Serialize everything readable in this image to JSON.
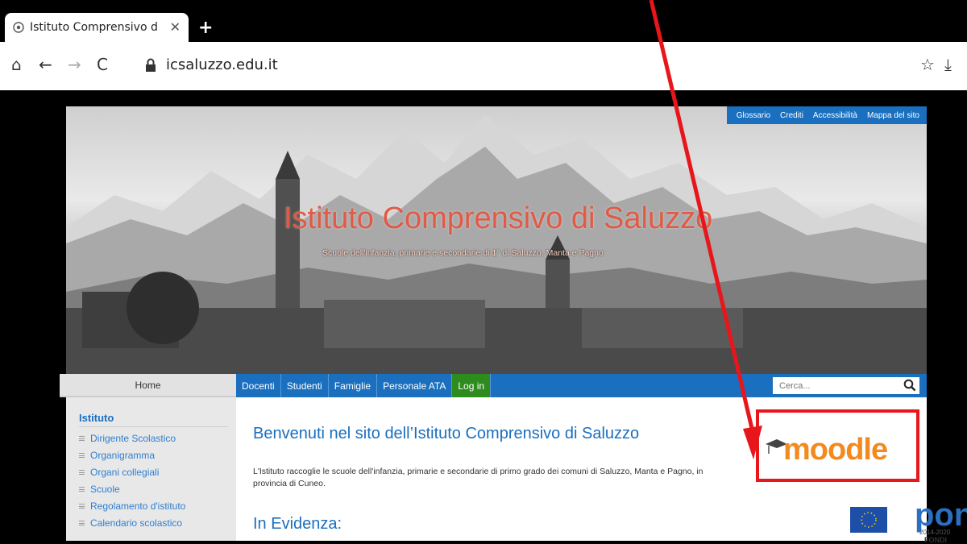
{
  "browser": {
    "tab_title": "Istituto Comprensivo di S",
    "url": "icsaluzzo.edu.it"
  },
  "site": {
    "toplinks": [
      "Glossario",
      "Crediti",
      "Accessibilità",
      "Mappa del sito"
    ],
    "title": "Istituto Comprensivo di Saluzzo",
    "subtitle": "Scuole dell'infanzia, primarie e secondarie di 1° di Saluzzo, Manta e Pagno",
    "nav": {
      "home": "Home",
      "items": [
        "Docenti",
        "Studenti",
        "Famiglie",
        "Personale ATA",
        "Log in"
      ],
      "search_placeholder": "Cerca..."
    },
    "sidebar": {
      "title": "Istituto",
      "items": [
        "Dirigente Scolastico",
        "Organigramma",
        "Organi collegiali",
        "Scuole",
        "Regolamento d'istituto",
        "Calendario scolastico"
      ]
    },
    "main": {
      "welcome": "Benvenuti nel sito dell’Istituto Comprensivo di Saluzzo",
      "intro": "L'Istituto raccoglie le scuole dell'infanzia, primarie e secondarie di primo grado dei comuni di Saluzzo, Manta e Pagno, in provincia di Cuneo.",
      "evidenza": "In Evidenza:",
      "moodle_logo": "moodle",
      "pon_logo": "pon",
      "pon_years": "2014-2020",
      "pon_fondi": "FONDI"
    }
  },
  "colors": {
    "accent_blue": "#1a6fbf",
    "login_green": "#2e8b1e",
    "title_red": "#e25a45",
    "moodle_orange": "#f28a1e",
    "annotation_red": "#e8161b"
  }
}
